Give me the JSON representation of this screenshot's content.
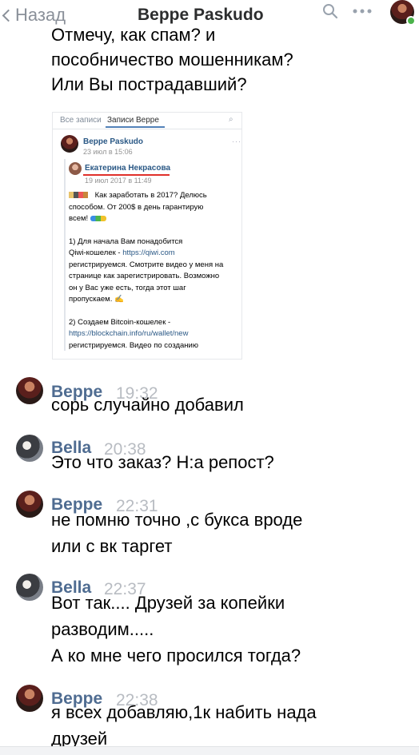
{
  "header": {
    "back_label": "Назад",
    "title": "Beppe Paskudo",
    "icons": [
      "chevron-left-icon",
      "search-icon",
      "more-icon",
      "avatar"
    ],
    "online_color": "#4bb34b"
  },
  "top_message": {
    "lines": [
      "Отмечу, как спам? и",
      "пособничество мошенникам?",
      "Или Вы пострадавший?"
    ]
  },
  "embedded_post": {
    "tab_all": "Все записи",
    "tab_beppe": "Записи Beppe",
    "author": "Beppe Paskudo",
    "date": "23 июл в 15:06",
    "repost_author": "Екатерина Некрасова",
    "repost_date": "19 июл 2017 в 11:49",
    "body": {
      "line1": "Как заработать в 2017? Делюсь",
      "line2": "способом. От 200$ в день гарантирую",
      "line3": "всем!",
      "step1_a": "1) Для начала Вам понадобится",
      "step1_b_prefix": "Qiwi-кошелек - ",
      "step1_b_link": "https://qiwi.com",
      "step1_c": "регистрируемся. Смотрите видео у меня на",
      "step1_d": "странице как зарегистрировать. Возможно",
      "step1_e": "он у Вас уже есть, тогда этот шаг",
      "step1_f": "пропускаем.",
      "step2_a": "2) Создаем Bitcoin-кошелек -",
      "step2_link": "https://blockchain.info/ru/wallet/new",
      "step2_c": "регистрируемся. Видео по созданию"
    }
  },
  "messages": [
    {
      "name": "Beppe",
      "time": "19:32",
      "avatar": "beppe",
      "lines": [
        "сорь случайно добавил"
      ]
    },
    {
      "name": "Bella",
      "time": "20:38",
      "avatar": "bella",
      "lines": [
        "Это что заказ? Н:а репост?"
      ]
    },
    {
      "name": "Beppe",
      "time": "22:31",
      "avatar": "beppe",
      "lines": [
        "не помню точно ,с букса вроде",
        "или с вк таргет"
      ]
    },
    {
      "name": "Bella",
      "time": "22:37",
      "avatar": "bella",
      "lines": [
        "Вот так.... Друзей за копейки",
        "разводим.....",
        "А ко мне чего просился тогда?"
      ]
    },
    {
      "name": "Beppe",
      "time": "22:38",
      "avatar": "beppe",
      "lines": [
        "я всех добавляю,1к набить нада",
        "друзей"
      ]
    }
  ]
}
